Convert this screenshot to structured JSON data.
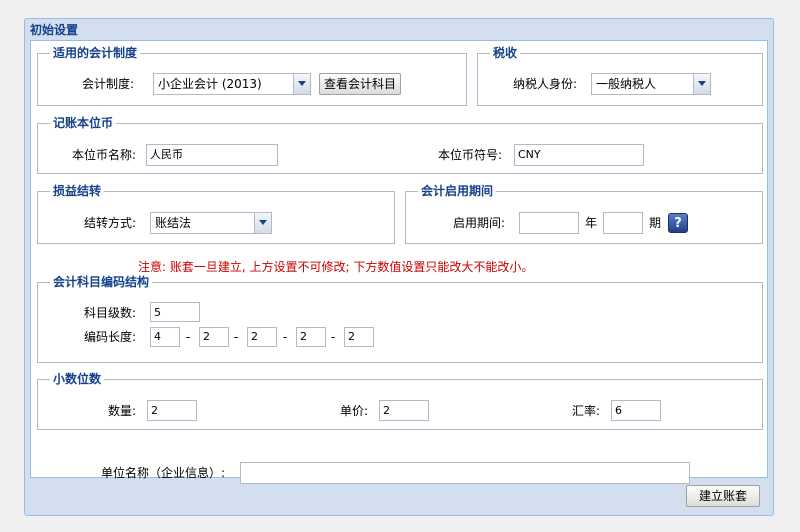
{
  "panel": {
    "title": "初始设置"
  },
  "accounting_system": {
    "legend": "适用的会计制度",
    "label": "会计制度:",
    "value": "小企业会计 (2013)",
    "view_button": "查看会计科目"
  },
  "tax": {
    "legend": "税收",
    "label": "纳税人身份:",
    "value": "一般纳税人"
  },
  "currency": {
    "legend": "记账本位币",
    "name_label": "本位币名称:",
    "name_value": "人民币",
    "symbol_label": "本位币符号:",
    "symbol_value": "CNY"
  },
  "profit_transfer": {
    "legend": "损益结转",
    "label": "结转方式:",
    "value": "账结法"
  },
  "period": {
    "legend": "会计启用期间",
    "label": "启用期间:",
    "year_value": "",
    "year_unit": "年",
    "period_value": "",
    "period_unit": "期",
    "help": "?"
  },
  "notice": "注意: 账套一旦建立, 上方设置不可修改; 下方数值设置只能改大不能改小。",
  "coding": {
    "legend": "会计科目编码结构",
    "level_label": "科目级数:",
    "level_value": "5",
    "length_label": "编码长度:",
    "lengths": [
      "4",
      "2",
      "2",
      "2",
      "2"
    ],
    "separator": "-"
  },
  "decimals": {
    "legend": "小数位数",
    "qty_label": "数量:",
    "qty_value": "2",
    "price_label": "单价:",
    "price_value": "2",
    "rate_label": "汇率:",
    "rate_value": "6"
  },
  "company": {
    "label": "单位名称（企业信息）:",
    "value": ""
  },
  "create_button": "建立账套"
}
